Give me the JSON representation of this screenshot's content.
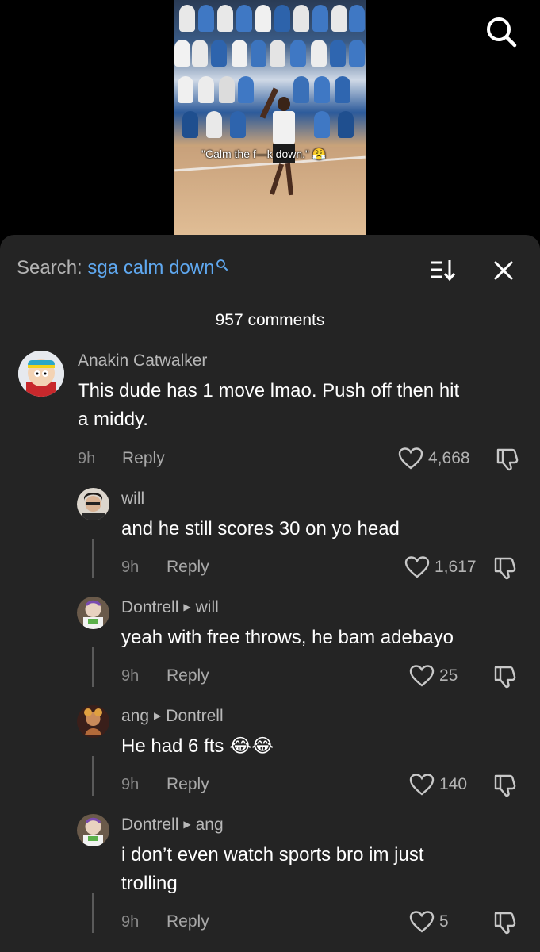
{
  "video": {
    "caption": "\"Calm the f—k down.\" 😤"
  },
  "search": {
    "prefix": "Search:",
    "query": "sga calm down"
  },
  "comment_count": "957 comments",
  "comments": [
    {
      "author": "Anakin Catwalker",
      "reply_to": "",
      "text_line1": "This dude has 1 move lmao. Push off then hit",
      "text_line2": "a middy.",
      "time": "9h",
      "reply_label": "Reply",
      "likes": "4,668"
    },
    {
      "author": "will",
      "reply_to": "",
      "text_line1": "and he still scores 30 on yo head",
      "time": "9h",
      "reply_label": "Reply",
      "likes": "1,617"
    },
    {
      "author": "Dontrell",
      "reply_to": "will",
      "text_line1": "yeah with free throws, he bam adebayo",
      "time": "9h",
      "reply_label": "Reply",
      "likes": "25"
    },
    {
      "author": "ang",
      "reply_to": "Dontrell",
      "text_line1": "He had 6 fts 😂😂",
      "time": "9h",
      "reply_label": "Reply",
      "likes": "140"
    },
    {
      "author": "Dontrell",
      "reply_to": "ang",
      "text_line1": "i don’t even watch sports bro im just",
      "text_line2": "trolling",
      "time": "9h",
      "reply_label": "Reply",
      "likes": "5"
    }
  ],
  "colors": {
    "sheet_bg": "#242424",
    "link_blue": "#5fa8f0",
    "muted_text": "#b8b8b8"
  },
  "icons": [
    "search-icon",
    "sort-icon",
    "close-icon",
    "heart-icon",
    "dislike-icon",
    "reply-arrow-icon"
  ]
}
